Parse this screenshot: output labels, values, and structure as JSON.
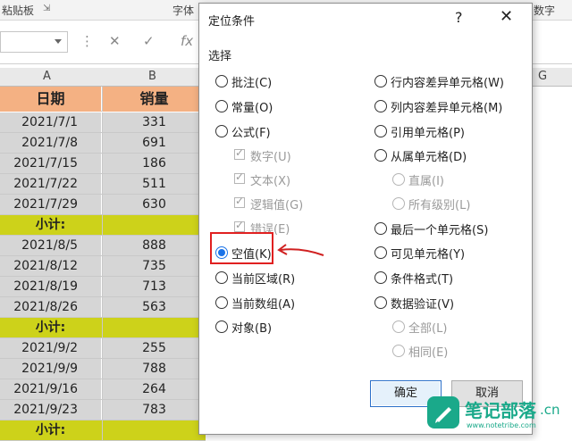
{
  "ribbon": {
    "clipboard": "粘贴板",
    "font": "字体",
    "number": "数字"
  },
  "formula_bar": {
    "cancel": "✕",
    "enter": "✓",
    "fx": "fx"
  },
  "columns": [
    "A",
    "B",
    "G"
  ],
  "sheet": {
    "header": {
      "date": "日期",
      "sales": "销量"
    },
    "rows": [
      {
        "type": "data",
        "date": "2021/7/1",
        "sales": "331"
      },
      {
        "type": "data",
        "date": "2021/7/8",
        "sales": "691"
      },
      {
        "type": "data",
        "date": "2021/7/15",
        "sales": "186"
      },
      {
        "type": "data",
        "date": "2021/7/22",
        "sales": "511"
      },
      {
        "type": "data",
        "date": "2021/7/29",
        "sales": "630"
      },
      {
        "type": "sub",
        "date": "小计:",
        "sales": ""
      },
      {
        "type": "data",
        "date": "2021/8/5",
        "sales": "888"
      },
      {
        "type": "data",
        "date": "2021/8/12",
        "sales": "735"
      },
      {
        "type": "data",
        "date": "2021/8/19",
        "sales": "713"
      },
      {
        "type": "data",
        "date": "2021/8/26",
        "sales": "563"
      },
      {
        "type": "sub",
        "date": "小计:",
        "sales": ""
      },
      {
        "type": "data",
        "date": "2021/9/2",
        "sales": "255"
      },
      {
        "type": "data",
        "date": "2021/9/9",
        "sales": "788"
      },
      {
        "type": "data",
        "date": "2021/9/16",
        "sales": "264"
      },
      {
        "type": "data",
        "date": "2021/9/23",
        "sales": "783"
      },
      {
        "type": "sub",
        "date": "小计:",
        "sales": ""
      }
    ]
  },
  "dialog": {
    "title": "定位条件",
    "help": "?",
    "close": "✕",
    "group_label": "选择",
    "left_options": {
      "comments": "批注(C)",
      "constants": "常量(O)",
      "formulas": "公式(F)",
      "numbers": "数字(U)",
      "text": "文本(X)",
      "logicals": "逻辑值(G)",
      "errors": "错误(E)",
      "blanks": "空值(K)",
      "current_region": "当前区域(R)",
      "current_array": "当前数组(A)",
      "objects": "对象(B)"
    },
    "right_options": {
      "row_diff": "行内容差异单元格(W)",
      "col_diff": "列内容差异单元格(M)",
      "precedents": "引用单元格(P)",
      "dependents": "从属单元格(D)",
      "direct": "直属(I)",
      "all_levels": "所有级别(L)",
      "last_cell": "最后一个单元格(S)",
      "visible": "可见单元格(Y)",
      "cond_format": "条件格式(T)",
      "data_validation": "数据验证(V)",
      "all": "全部(L)",
      "same": "相同(E)"
    },
    "ok": "确定",
    "cancel": "取消"
  },
  "watermark": {
    "text": "笔记部落",
    "suffix": ".cn",
    "url": "www.notetribe.com"
  },
  "colors": {
    "header": "#f4b183",
    "subtotal": "#cdd21a",
    "accent": "#1a73e8",
    "highlight": "#e02020",
    "watermark": "#1aa98a"
  }
}
